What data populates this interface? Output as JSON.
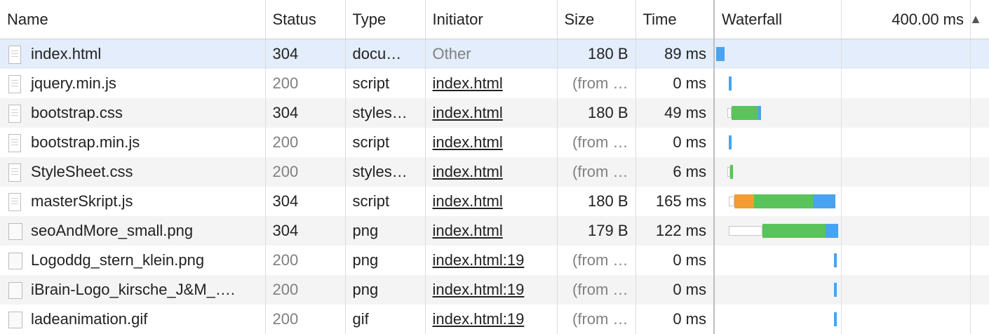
{
  "columns": {
    "name": "Name",
    "status": "Status",
    "type": "Type",
    "initiator": "Initiator",
    "size": "Size",
    "time": "Time",
    "waterfall": "Waterfall",
    "waterfall_time": "400.00 ms",
    "sort_arrow": "▲"
  },
  "icons": {
    "document": "file-document-icon",
    "image": "image-file-icon",
    "sort": "sort-ascending-icon"
  },
  "colors": {
    "selected_row": "#e3edfb",
    "waiting_ttfb": "#5bc35c",
    "content_download": "#4aa3f0",
    "ssl": "#f39c31"
  },
  "rows": [
    {
      "name": "index.html",
      "status": "304",
      "type": "docu…",
      "initiator": "Other",
      "size": "180 B",
      "time": "89 ms",
      "icon": "doc",
      "selected": true
    },
    {
      "name": "jquery.min.js",
      "status": "200",
      "type": "script",
      "initiator": "index.html",
      "size": "(from …",
      "time": "0 ms",
      "icon": "doc"
    },
    {
      "name": "bootstrap.css",
      "status": "304",
      "type": "styles…",
      "initiator": "index.html",
      "size": "180 B",
      "time": "49 ms",
      "icon": "doc"
    },
    {
      "name": "bootstrap.min.js",
      "status": "200",
      "type": "script",
      "initiator": "index.html",
      "size": "(from …",
      "time": "0 ms",
      "icon": "doc"
    },
    {
      "name": "StyleSheet.css",
      "status": "200",
      "type": "styles…",
      "initiator": "index.html",
      "size": "(from …",
      "time": "6 ms",
      "icon": "doc"
    },
    {
      "name": "masterSkript.js",
      "status": "304",
      "type": "script",
      "initiator": "index.html",
      "size": "180 B",
      "time": "165 ms",
      "icon": "doc"
    },
    {
      "name": "seoAndMore_small.png",
      "status": "304",
      "type": "png",
      "initiator": "index.html",
      "size": "179 B",
      "time": "122 ms",
      "icon": "img"
    },
    {
      "name": "Logoddg_stern_klein.png",
      "status": "200",
      "type": "png",
      "initiator": "index.html:19",
      "size": "(from …",
      "time": "0 ms",
      "icon": "img"
    },
    {
      "name": "iBrain-Logo_kirsche_J&M_….",
      "status": "200",
      "type": "png",
      "initiator": "index.html:19",
      "size": "(from …",
      "time": "0 ms",
      "icon": "img"
    },
    {
      "name": "ladeanimation.gif",
      "status": "200",
      "type": "gif",
      "initiator": "index.html:19",
      "size": "(from …",
      "time": "0 ms",
      "icon": "img"
    }
  ]
}
